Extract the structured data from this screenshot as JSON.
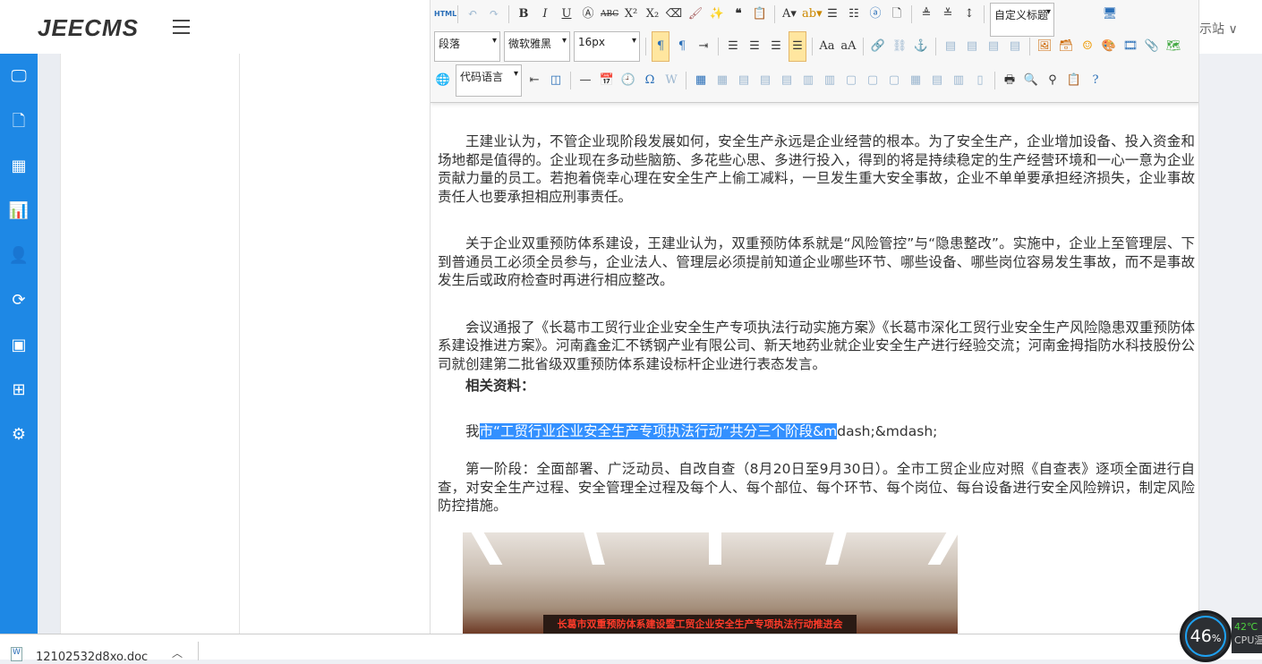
{
  "app": {
    "logo": "JEECMS",
    "site_switch": "示站 ∨"
  },
  "sidebar": {
    "items": [
      {
        "icon": "monitor-icon",
        "glyph": "🖵"
      },
      {
        "icon": "document-icon",
        "glyph": "🗋"
      },
      {
        "icon": "grid-icon",
        "glyph": "▦"
      },
      {
        "icon": "chart-icon",
        "glyph": "📊"
      },
      {
        "icon": "user-icon",
        "glyph": "👤"
      },
      {
        "icon": "refresh-icon",
        "glyph": "⟳"
      },
      {
        "icon": "box-icon",
        "glyph": "▣"
      },
      {
        "icon": "modules-icon",
        "glyph": "⊞"
      },
      {
        "icon": "settings-icon",
        "glyph": "⚙"
      }
    ]
  },
  "editor": {
    "toolbar": {
      "html": "HTML",
      "custom_heading": "自定义标题",
      "paragraph": "段落",
      "font_family": "微软雅黑",
      "font_size": "16px",
      "code_language": "代码语言"
    },
    "paragraphs": [
      "王建业认为，不管企业现阶段发展如何，安全生产永远是企业经营的根本。为了安全生产，企业增加设备、投入资金和场地都是值得的。企业现在多动些脑筋、多花些心思、多进行投入，得到的将是持续稳定的生产经营环境和一心一意为企业贡献力量的员工。若抱着侥幸心理在安全生产上偷工减料，一旦发生重大安全事故，企业不单单要承担经济损失，企业事故责任人也要承担相应刑事责任。",
      "关于企业双重预防体系建设，王建业认为，双重预防体系就是“风险管控”与“隐患整改”。实施中，企业上至管理层、下到普通员工必须全员参与，企业法人、管理层必须提前知道企业哪些环节、哪些设备、哪些岗位容易发生事故，而不是事故发生后或政府检查时再进行相应整改。",
      "会议通报了《长葛市工贸行业企业安全生产专项执法行动实施方案》《长葛市深化工贸行业安全生产风险隐患双重预防体系建设推进方案》。河南鑫金汇不锈钢产业有限公司、新天地药业就企业安全生产进行经验交流；河南金拇指防水科技股份公司就创建第二批省级双重预防体系建设标杆企业进行表态发言。"
    ],
    "related_heading": "相关资料：",
    "selected_line": {
      "before": "我",
      "selected": "市“工贸行业企业安全生产专项执法行动”共分三个阶段&m",
      "after": "dash;&mdash;"
    },
    "stage1": "第一阶段：全面部署、广泛动员、自改自查（8月20日至9月30日）。全市工贸企业应对照《自查表》逐项全面进行自查，对安全生产过程、安全管理全过程及每个人、每个部位、每个环节、每个岗位、每台设备进行安全风险辨识，制定风险防控措施。",
    "photo_banner": "长葛市双重预防体系建设暨工贸企业安全生产专项执法行动推进会"
  },
  "download_bar": {
    "file_name": "12102532d8xo.doc"
  },
  "system_monitor": {
    "load_percent": "46",
    "percent_sign": "%",
    "cpu_temp": "42℃",
    "cpu_label": "CPU温"
  }
}
